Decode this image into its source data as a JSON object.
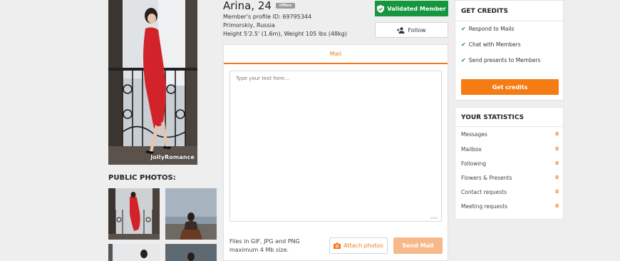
{
  "profile": {
    "name": "Arina, 24",
    "status": "Offline",
    "id_line": "Member's profile ID: 69795344",
    "location": "Primorskiy, Russia",
    "measurements": "Height 5'2.5' (1.6m), Weight 105 lbs (48kg)",
    "photo_watermark": "JollyRomance"
  },
  "actions": {
    "validated_label": "Validated Member",
    "follow_label": "Follow"
  },
  "photos": {
    "public_title": "PUBLIC PHOTOS:"
  },
  "mail": {
    "tab_label": "Mail",
    "placeholder": "Type your text here...",
    "char_count": "0/500",
    "files_note_line1": "Files in GIF, JPG and PNG",
    "files_note_line2": "maximum 4 Mb size.",
    "attach_label": "Attach photos",
    "send_label": "Send Mail"
  },
  "credits": {
    "title": "GET CREDITS",
    "items": [
      "Respond to Mails",
      "Chat with Members",
      "Send presents to Members"
    ],
    "button_label": "Get credits"
  },
  "statistics": {
    "title": "YOUR STATISTICS",
    "rows": [
      {
        "label": "Messages",
        "value": "0"
      },
      {
        "label": "Mailbox",
        "value": "0"
      },
      {
        "label": "Following",
        "value": "0"
      },
      {
        "label": "Flowers & Presents",
        "value": "0"
      },
      {
        "label": "Contact requests",
        "value": "0"
      },
      {
        "label": "Meeting requests",
        "value": "0"
      }
    ]
  },
  "colors": {
    "accent": "#f37a1f",
    "validated": "#16963f",
    "send_disabled": "#f7b98a"
  },
  "icons": {
    "validated": "shield-check-icon",
    "follow": "add-user-icon",
    "attach": "camera-icon",
    "check": "checkmark-icon"
  }
}
